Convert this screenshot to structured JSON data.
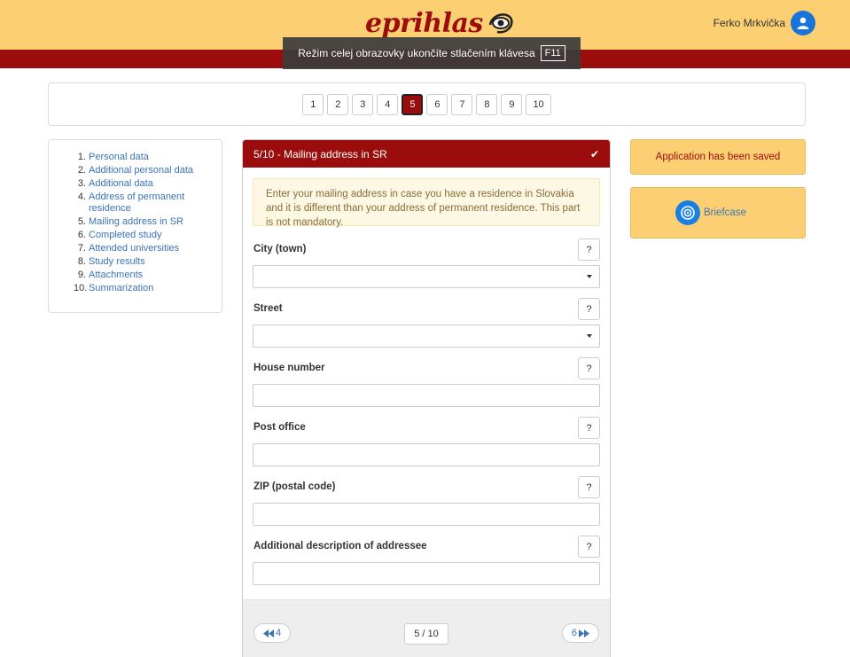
{
  "header": {
    "logo_text": "eprihlas",
    "user_name": "Ferko Mrkvička",
    "fullscreen_msg": "Režim celej obrazovky ukončíte stlačením klávesa",
    "fullscreen_key": "F11"
  },
  "pager": {
    "pages": [
      "1",
      "2",
      "3",
      "4",
      "5",
      "6",
      "7",
      "8",
      "9",
      "10"
    ],
    "active": "5"
  },
  "steps": [
    {
      "num": "1.",
      "label": "Personal data"
    },
    {
      "num": "2.",
      "label": "Additional personal data"
    },
    {
      "num": "3.",
      "label": "Additional data"
    },
    {
      "num": "4.",
      "label": "Address of permanent residence"
    },
    {
      "num": "5.",
      "label": "Mailing address in SR"
    },
    {
      "num": "6.",
      "label": "Completed study"
    },
    {
      "num": "7.",
      "label": "Attended universities"
    },
    {
      "num": "8.",
      "label": "Study results"
    },
    {
      "num": "9.",
      "label": "Attachments"
    },
    {
      "num": "10.",
      "label": "Summarization"
    }
  ],
  "panel": {
    "title": "5/10 - Mailing address in SR",
    "check": "✔",
    "notice": "Enter your mailing address in case you have a residence in Slovakia and it is different than your address of permanent residence. This part is not mandatory.",
    "help": "?",
    "fields": [
      {
        "label": "City (town)",
        "value": "",
        "type": "select"
      },
      {
        "label": "Street",
        "value": "",
        "type": "select"
      },
      {
        "label": "House number",
        "value": "",
        "type": "text"
      },
      {
        "label": "Post office",
        "value": "",
        "type": "text"
      },
      {
        "label": "ZIP (postal code)",
        "value": "",
        "type": "text"
      },
      {
        "label": "Additional description of addressee",
        "value": "",
        "type": "text"
      }
    ],
    "prev_label": "4",
    "next_label": "6",
    "counter": "5 / 10"
  },
  "right": {
    "saved": "Application has been saved",
    "briefcase": "Briefcase"
  },
  "colors": {
    "brand_red": "#9b0d0d",
    "header_yellow": "#fdcf73",
    "link_blue": "#3a73b8",
    "icon_blue": "#1a73d9"
  }
}
